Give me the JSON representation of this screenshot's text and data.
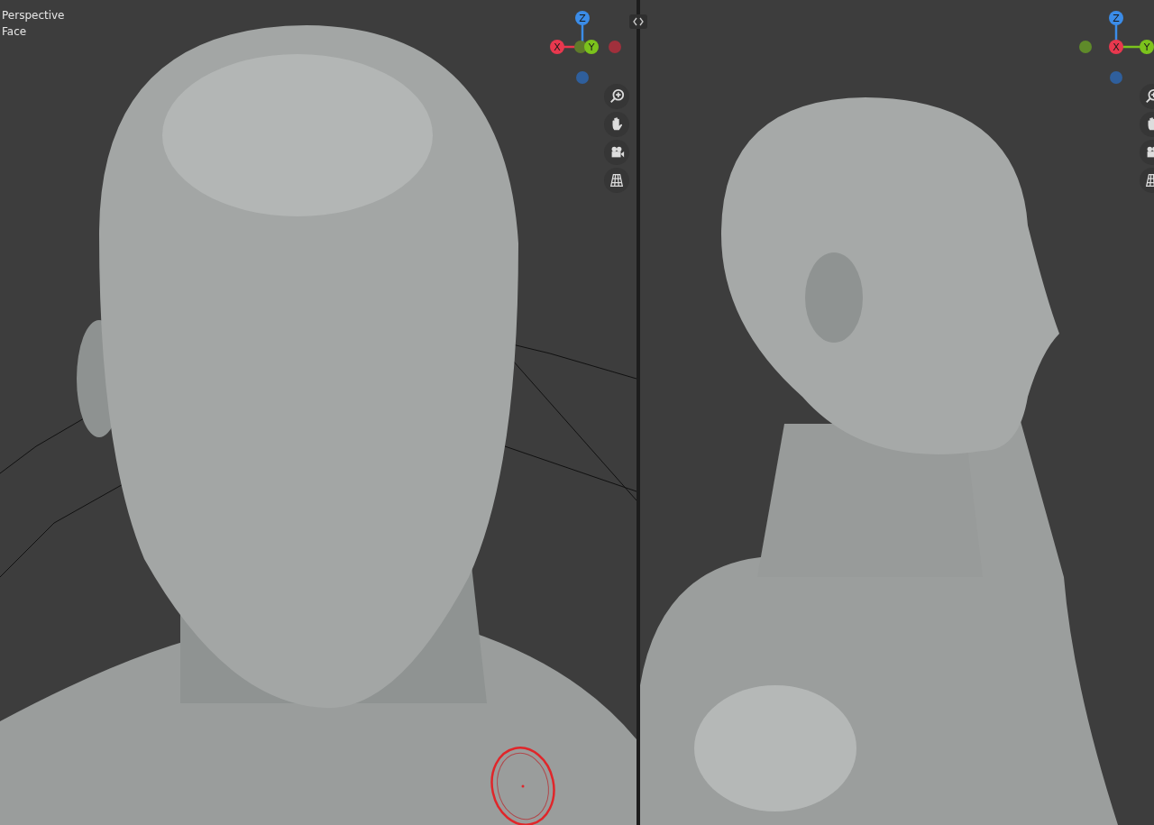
{
  "viewports": [
    {
      "overlay_lines": [
        "Perspective",
        "Face"
      ],
      "gizmo": {
        "z": "Z",
        "x": "X",
        "y": "Y"
      },
      "brush_cursor": true
    },
    {
      "gizmo": {
        "z": "Z",
        "x": "X",
        "y": "Y"
      }
    }
  ]
}
